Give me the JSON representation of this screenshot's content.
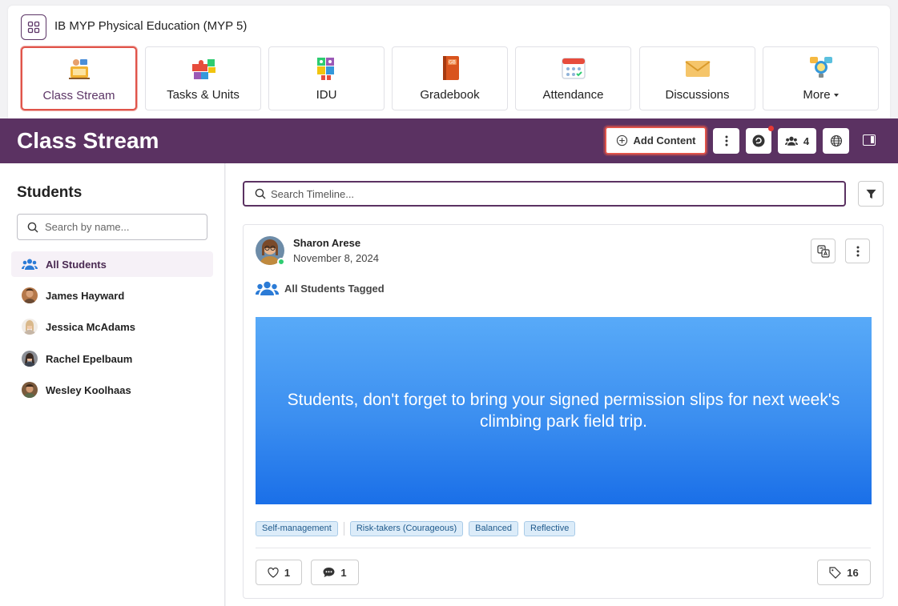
{
  "course": {
    "title": "IB MYP Physical Education (MYP 5)",
    "icon": "apps-grid-icon"
  },
  "nav_tiles": [
    {
      "label": "Class Stream",
      "icon": "class-stream-icon",
      "active": true
    },
    {
      "label": "Tasks & Units",
      "icon": "puzzle-icon"
    },
    {
      "label": "IDU",
      "icon": "puzzle-robot-icon"
    },
    {
      "label": "Gradebook",
      "icon": "gradebook-book-icon",
      "badge": "GB"
    },
    {
      "label": "Attendance",
      "icon": "calendar-icon"
    },
    {
      "label": "Discussions",
      "icon": "envelope-icon"
    },
    {
      "label": "More",
      "icon": "lightbulb-chat-icon"
    }
  ],
  "header": {
    "title": "Class Stream",
    "add_content_label": "Add Content",
    "members_count": "4"
  },
  "sidebar": {
    "title": "Students",
    "search_placeholder": "Search by name...",
    "items": [
      {
        "label": "All Students"
      },
      {
        "label": "James Hayward"
      },
      {
        "label": "Jessica McAdams"
      },
      {
        "label": "Rachel Epelbaum"
      },
      {
        "label": "Wesley Koolhaas"
      }
    ]
  },
  "timeline": {
    "search_placeholder": "Search Timeline..."
  },
  "post": {
    "author": "Sharon Arese",
    "date": "November 8, 2024",
    "tagged": "All Students Tagged",
    "message": "Students, don't forget to bring your signed permission slips for next week's climbing park field trip.",
    "tags": [
      "Self-management",
      "Risk-takers (Courageous)",
      "Balanced",
      "Reflective"
    ],
    "likes": "1",
    "comments": "1",
    "tag_count": "16"
  },
  "colors": {
    "brand_purple": "#5b3262",
    "highlight_red": "#e0544a",
    "banner_blue": "#3b8ef0",
    "online_green": "#2ecc71"
  }
}
